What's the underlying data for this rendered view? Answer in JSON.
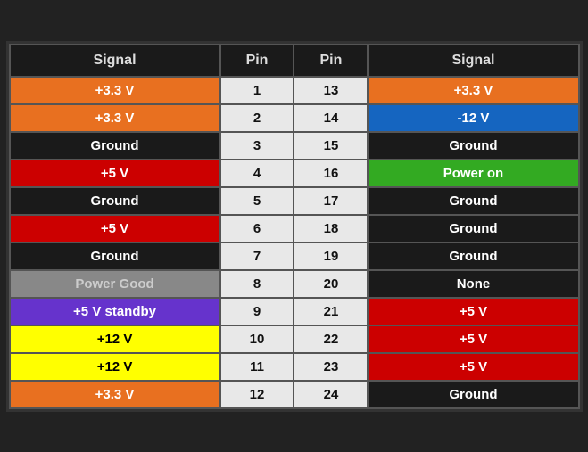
{
  "headers": [
    "Signal",
    "Pin",
    "Pin",
    "Signal"
  ],
  "rows": [
    {
      "left": {
        "label": "+3.3 V",
        "class": "bg-orange"
      },
      "pinLeft": "1",
      "pinRight": "13",
      "right": {
        "label": "+3.3 V",
        "class": "bg-orange"
      }
    },
    {
      "left": {
        "label": "+3.3 V",
        "class": "bg-orange"
      },
      "pinLeft": "2",
      "pinRight": "14",
      "right": {
        "label": "-12 V",
        "class": "bg-blue"
      }
    },
    {
      "left": {
        "label": "Ground",
        "class": "bg-black"
      },
      "pinLeft": "3",
      "pinRight": "15",
      "right": {
        "label": "Ground",
        "class": "bg-black"
      }
    },
    {
      "left": {
        "label": "+5 V",
        "class": "bg-red"
      },
      "pinLeft": "4",
      "pinRight": "16",
      "right": {
        "label": "Power on",
        "class": "bg-green"
      }
    },
    {
      "left": {
        "label": "Ground",
        "class": "bg-black"
      },
      "pinLeft": "5",
      "pinRight": "17",
      "right": {
        "label": "Ground",
        "class": "bg-black"
      }
    },
    {
      "left": {
        "label": "+5 V",
        "class": "bg-red"
      },
      "pinLeft": "6",
      "pinRight": "18",
      "right": {
        "label": "Ground",
        "class": "bg-black"
      }
    },
    {
      "left": {
        "label": "Ground",
        "class": "bg-black"
      },
      "pinLeft": "7",
      "pinRight": "19",
      "right": {
        "label": "Ground",
        "class": "bg-black"
      }
    },
    {
      "left": {
        "label": "Power Good",
        "class": "bg-gray"
      },
      "pinLeft": "8",
      "pinRight": "20",
      "right": {
        "label": "None",
        "class": "bg-black"
      }
    },
    {
      "left": {
        "label": "+5 V standby",
        "class": "bg-purple"
      },
      "pinLeft": "9",
      "pinRight": "21",
      "right": {
        "label": "+5 V",
        "class": "bg-red"
      }
    },
    {
      "left": {
        "label": "+12 V",
        "class": "bg-yellow"
      },
      "pinLeft": "10",
      "pinRight": "22",
      "right": {
        "label": "+5 V",
        "class": "bg-red"
      }
    },
    {
      "left": {
        "label": "+12 V",
        "class": "bg-yellow"
      },
      "pinLeft": "11",
      "pinRight": "23",
      "right": {
        "label": "+5 V",
        "class": "bg-red"
      }
    },
    {
      "left": {
        "label": "+3.3 V",
        "class": "bg-orange"
      },
      "pinLeft": "12",
      "pinRight": "24",
      "right": {
        "label": "Ground",
        "class": "bg-black"
      }
    }
  ]
}
